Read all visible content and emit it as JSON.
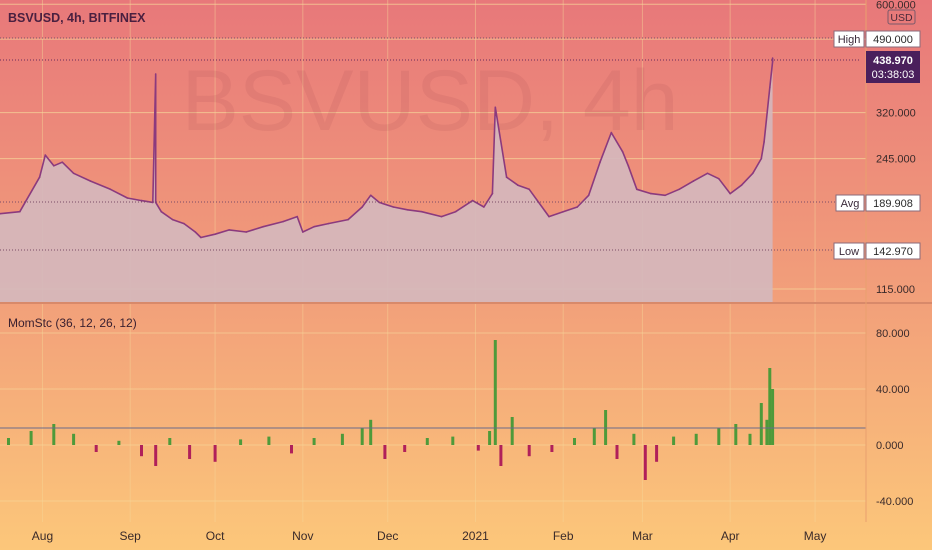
{
  "colors": {
    "bg_top": "#e8787a",
    "bg_mid": "#f2a07a",
    "bg_bottom": "#fcc77a",
    "price_line": "#8b3a7e",
    "price_fill": "#d4b8be",
    "momentum_up": "#4e9a3a",
    "momentum_down": "#b0205a",
    "gridline": "#f7d89a",
    "label_dark": "#4a1f5c"
  },
  "header": {
    "symbol_line": "BSVUSD, 4h, BITFINEX",
    "watermark": "BSVUSD, 4h",
    "currency_badge": "USD"
  },
  "price_markers": {
    "high_tag": "High",
    "high_value": "490.000",
    "current_value": "438.970",
    "countdown": "03:38:03",
    "avg_tag": "Avg",
    "avg_value": "189.908",
    "low_tag": "Low",
    "low_value": "142.970"
  },
  "indicator": {
    "label": "MomStc (36, 12, 26, 12)"
  },
  "chart_data": [
    {
      "type": "line",
      "y_scale": "log",
      "ylim": [
        106,
        615
      ],
      "y_ticks": [
        "600.000",
        "490.000",
        "320.000",
        "245.000",
        "115.000"
      ],
      "y_tick_values": [
        600,
        490,
        320,
        245,
        115
      ],
      "x_labels": [
        "Aug",
        "Sep",
        "Oct",
        "Nov",
        "Dec",
        "2021",
        "Feb",
        "Mar",
        "Apr",
        "May"
      ],
      "x_label_dates": [
        "2020-08-01",
        "2020-09-01",
        "2020-10-01",
        "2020-11-01",
        "2020-12-01",
        "2021-01-01",
        "2021-02-01",
        "2021-03-01",
        "2021-04-01",
        "2021-05-01"
      ],
      "xlim": [
        "2020-07-17",
        "2021-05-19"
      ],
      "series": [
        {
          "x": [
            "2020-07-17",
            "2020-07-24",
            "2020-07-31",
            "2020-08-02",
            "2020-08-05",
            "2020-08-08",
            "2020-08-12",
            "2020-08-18",
            "2020-08-25",
            "2020-08-31",
            "2020-09-05",
            "2020-09-09",
            "2020-09-10",
            "2020-09-10",
            "2020-09-12",
            "2020-09-16",
            "2020-09-20",
            "2020-09-24",
            "2020-09-26",
            "2020-10-01",
            "2020-10-06",
            "2020-10-12",
            "2020-10-18",
            "2020-10-25",
            "2020-10-30",
            "2020-11-01",
            "2020-11-05",
            "2020-11-10",
            "2020-11-17",
            "2020-11-22",
            "2020-11-25",
            "2020-11-28",
            "2020-12-03",
            "2020-12-08",
            "2020-12-13",
            "2020-12-20",
            "2020-12-25",
            "2020-12-31",
            "2021-01-04",
            "2021-01-07",
            "2021-01-08",
            "2021-01-12",
            "2021-01-16",
            "2021-01-20",
            "2021-01-27",
            "2021-02-01",
            "2021-02-06",
            "2021-02-10",
            "2021-02-14",
            "2021-02-18",
            "2021-02-22",
            "2021-02-24",
            "2021-02-27",
            "2021-03-04",
            "2021-03-09",
            "2021-03-14",
            "2021-03-19",
            "2021-03-24",
            "2021-03-28",
            "2021-04-01",
            "2021-04-05",
            "2021-04-09",
            "2021-04-12",
            "2021-04-13",
            "2021-04-15",
            "2021-04-16",
            "2021-04-16"
          ],
          "values": [
            178,
            180,
            220,
            250,
            235,
            240,
            225,
            215,
            205,
            195,
            192,
            190,
            400,
            190,
            180,
            172,
            168,
            160,
            155,
            158,
            162,
            160,
            165,
            170,
            175,
            160,
            165,
            168,
            172,
            185,
            198,
            190,
            185,
            182,
            180,
            175,
            180,
            192,
            185,
            200,
            330,
            220,
            210,
            205,
            175,
            180,
            185,
            198,
            240,
            285,
            255,
            235,
            205,
            200,
            198,
            205,
            215,
            225,
            218,
            200,
            210,
            225,
            245,
            270,
            370,
            430,
            438.97
          ]
        }
      ]
    },
    {
      "type": "bar",
      "title": "MomStc (36, 12, 26, 12)",
      "ylim": [
        -55,
        100
      ],
      "y_ticks": [
        "80.000",
        "40.000",
        "0.000",
        "-40.000"
      ],
      "y_tick_values": [
        80,
        40,
        0,
        -40
      ],
      "baseline": 0,
      "series": [
        {
          "x": [
            "2020-07-20",
            "2020-07-28",
            "2020-08-05",
            "2020-08-12",
            "2020-08-20",
            "2020-08-28",
            "2020-09-05",
            "2020-09-10",
            "2020-09-15",
            "2020-09-22",
            "2020-10-01",
            "2020-10-10",
            "2020-10-20",
            "2020-10-28",
            "2020-11-05",
            "2020-11-15",
            "2020-11-22",
            "2020-11-25",
            "2020-11-30",
            "2020-12-07",
            "2020-12-15",
            "2020-12-24",
            "2021-01-02",
            "2021-01-06",
            "2021-01-08",
            "2021-01-10",
            "2021-01-14",
            "2021-01-20",
            "2021-01-28",
            "2021-02-05",
            "2021-02-12",
            "2021-02-16",
            "2021-02-20",
            "2021-02-26",
            "2021-03-02",
            "2021-03-06",
            "2021-03-12",
            "2021-03-20",
            "2021-03-28",
            "2021-04-03",
            "2021-04-08",
            "2021-04-12",
            "2021-04-14",
            "2021-04-15",
            "2021-04-16"
          ],
          "values": [
            5,
            10,
            15,
            8,
            -5,
            3,
            -8,
            -15,
            5,
            -10,
            -12,
            4,
            6,
            -6,
            5,
            8,
            12,
            18,
            -10,
            -5,
            5,
            6,
            -4,
            10,
            75,
            -15,
            20,
            -8,
            -5,
            5,
            12,
            25,
            -10,
            8,
            -25,
            -12,
            6,
            8,
            12,
            15,
            8,
            30,
            18,
            55,
            40
          ]
        }
      ]
    }
  ]
}
